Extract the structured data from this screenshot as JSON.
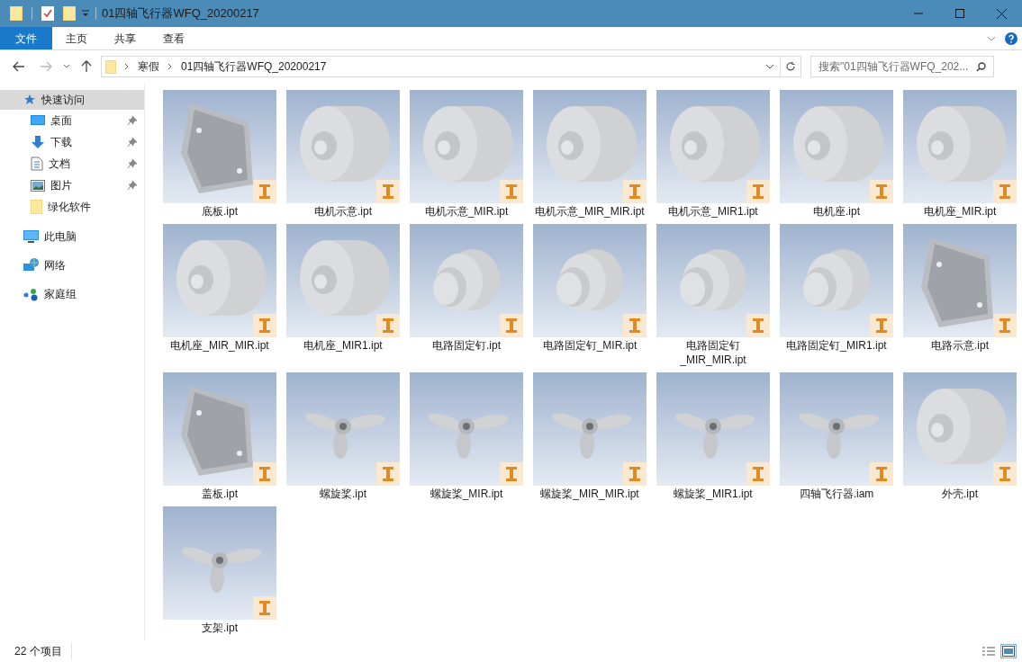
{
  "window": {
    "title": "01四轴飞行器WFQ_20200217"
  },
  "ribbon_tabs": [
    {
      "label": "文件",
      "kind": "file"
    },
    {
      "label": "主页",
      "kind": "tab"
    },
    {
      "label": "共享",
      "kind": "tab"
    },
    {
      "label": "查看",
      "kind": "tab"
    }
  ],
  "address_bar": {
    "path": [
      "寒假",
      "01四轴飞行器WFQ_20200217"
    ]
  },
  "search": {
    "placeholder": "搜索\"01四轴飞行器WFQ_202..."
  },
  "sidebar": [
    {
      "label": "快速访问",
      "kind": "quick",
      "selected": true,
      "children": [
        {
          "label": "桌面",
          "kind": "desktop",
          "pinned": true,
          "selected": false
        },
        {
          "label": "下载",
          "kind": "download",
          "pinned": true,
          "selected": false
        },
        {
          "label": "文档",
          "kind": "document",
          "pinned": true,
          "selected": false
        },
        {
          "label": "图片",
          "kind": "pictures",
          "pinned": true,
          "selected": false
        },
        {
          "label": "绿化软件",
          "kind": "folder",
          "pinned": false,
          "selected": false
        }
      ]
    },
    {
      "label": "此电脑",
      "kind": "pc",
      "selected": false
    },
    {
      "label": "网络",
      "kind": "network",
      "selected": false
    },
    {
      "label": "家庭组",
      "kind": "homegroup",
      "selected": false
    }
  ],
  "files": [
    {
      "name": "底板.ipt"
    },
    {
      "name": "电机示意.ipt"
    },
    {
      "name": "电机示意_MIR.ipt"
    },
    {
      "name": "电机示意_MIR_MIR.ipt"
    },
    {
      "name": "电机示意_MIR1.ipt"
    },
    {
      "name": "电机座.ipt"
    },
    {
      "name": "电机座_MIR.ipt"
    },
    {
      "name": "电机座_MIR_MIR.ipt"
    },
    {
      "name": "电机座_MIR1.ipt"
    },
    {
      "name": "电路固定钉.ipt"
    },
    {
      "name": "电路固定钉_MIR.ipt"
    },
    {
      "name": "电路固定钉_MIR_MIR.ipt"
    },
    {
      "name": "电路固定钉_MIR1.ipt"
    },
    {
      "name": "电路示意.ipt"
    },
    {
      "name": "盖板.ipt"
    },
    {
      "name": "螺旋桨.ipt"
    },
    {
      "name": "螺旋桨_MIR.ipt"
    },
    {
      "name": "螺旋桨_MIR_MIR.ipt"
    },
    {
      "name": "螺旋桨_MIR1.ipt"
    },
    {
      "name": "四轴飞行器.iam"
    },
    {
      "name": "外壳.ipt"
    },
    {
      "name": "支架.ipt"
    }
  ],
  "status_bar": {
    "count": "22 个项目",
    "views": [
      {
        "kind": "details",
        "selected": false
      },
      {
        "kind": "large_icons",
        "selected": true
      }
    ]
  }
}
